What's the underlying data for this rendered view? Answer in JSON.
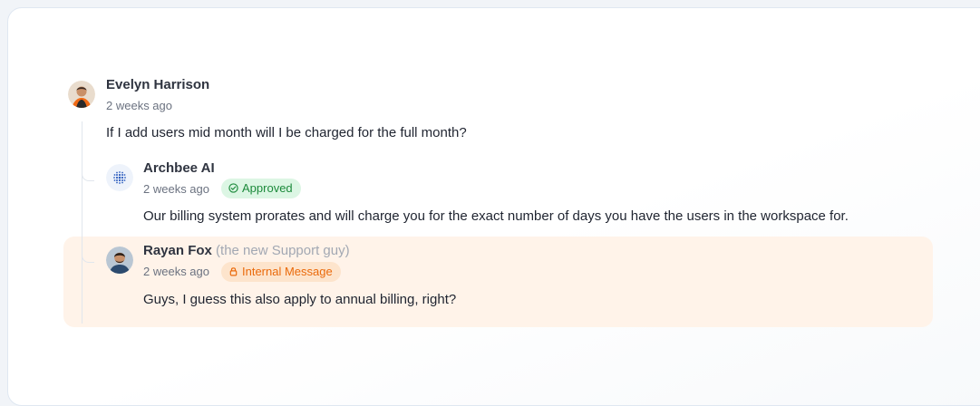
{
  "thread": {
    "root": {
      "author": "Evelyn Harrison",
      "time": "2 weeks ago",
      "text": "If I add users mid month will I be charged for the full month?"
    },
    "replies": [
      {
        "author": "Archbee AI",
        "time": "2 weeks ago",
        "badge": "Approved",
        "badge_icon": "check-circle-icon",
        "text": "Our billing system prorates and will charge you for the exact number of days you have the users in the workspace for."
      },
      {
        "author": "Rayan Fox",
        "author_note": "(the new Support guy)",
        "time": "2 weeks ago",
        "badge": "Internal Message",
        "badge_icon": "lock-icon",
        "text": "Guys, I guess this also apply to annual billing, right?"
      }
    ]
  },
  "colors": {
    "approved_bg": "#dcf6e4",
    "approved_text": "#1c8a3b",
    "internal_bg": "#fde4cc",
    "internal_text": "#ea6a0b",
    "internal_highlight": "#fff3e9"
  }
}
